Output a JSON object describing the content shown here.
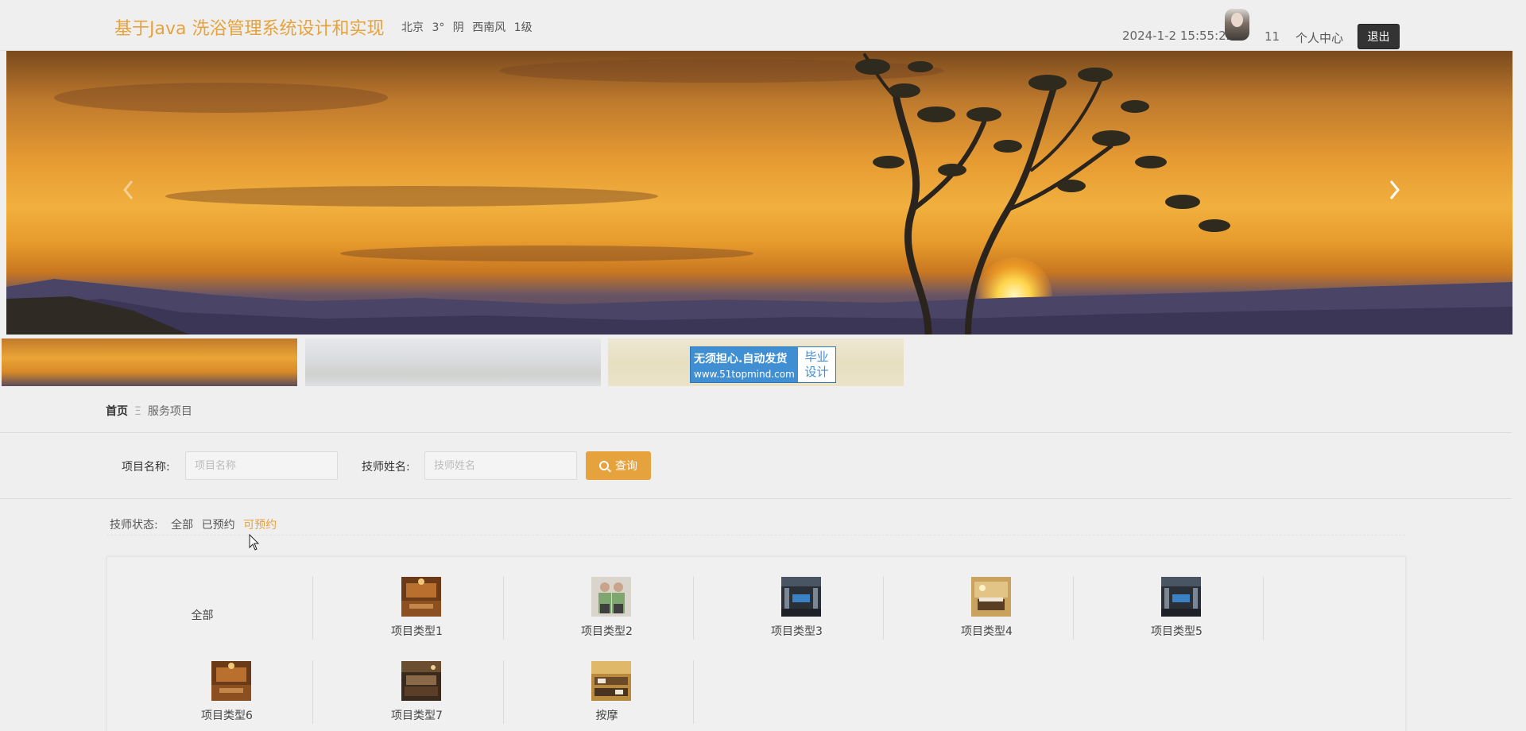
{
  "header": {
    "title": "基于Java 洗浴管理系统设计和实现",
    "weather": "北京 3° 阴 西南风 1级",
    "datetime": "2024-1-2 15:55:22",
    "username": "11",
    "center_label": "个人中心",
    "logout_label": "退出"
  },
  "promo": {
    "main": "无须担心.自动发货",
    "url": "www.51topmind.com",
    "box_line1": "毕业",
    "box_line2": "设计"
  },
  "breadcrumb": {
    "home": "首页",
    "separator": "Ξ",
    "current": "服务项目"
  },
  "search": {
    "item_label": "项目名称:",
    "item_placeholder": "项目名称",
    "tech_label": "技师姓名:",
    "tech_placeholder": "技师姓名",
    "button_label": "查询"
  },
  "filter": {
    "title": "技师状态:",
    "options": [
      "全部",
      "已预约",
      "可预约"
    ],
    "active_index": 2
  },
  "categories": [
    "全部",
    "项目类型1",
    "项目类型2",
    "项目类型3",
    "项目类型4",
    "项目类型5",
    "项目类型6",
    "项目类型7",
    "按摩"
  ],
  "colors": {
    "accent": "#e6a23c",
    "dark_button": "#333333",
    "promo_blue": "#3f8fd2"
  }
}
